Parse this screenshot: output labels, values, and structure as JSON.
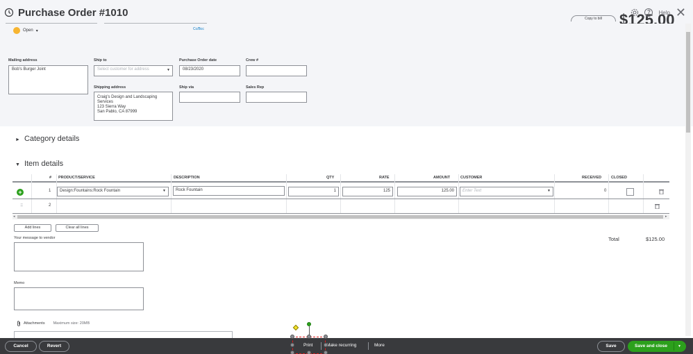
{
  "header": {
    "title": "Purchase Order #1010",
    "status": "Open",
    "cc_bcc": "Cc/Bcc",
    "copy_to_bill": "Copy to bill",
    "amount_big": "$125.00",
    "help": "Help"
  },
  "form": {
    "mailing_address_label": "Mailing address",
    "mailing_address": "Bob's Burger Joint",
    "ship_to_label": "Ship to",
    "ship_to_placeholder": "Select customer for address",
    "po_date_label": "Purchase Order date",
    "po_date": "08/23/2020",
    "crew_label": "Crew #",
    "shipping_address_label": "Shipping address",
    "shipping_address_lines": [
      "Craig's Design and Landscaping",
      "Services",
      "123 Sierra Way",
      "San Pablo, CA  87999"
    ],
    "ship_via_label": "Ship via",
    "sales_rep_label": "Sales Rep"
  },
  "sections": {
    "category_details": "Category details",
    "item_details": "Item details"
  },
  "table": {
    "headers": {
      "num": "#",
      "product": "PRODUCT/SERVICE",
      "description": "DESCRIPTION",
      "qty": "QTY",
      "rate": "RATE",
      "amount": "AMOUNT",
      "customer": "CUSTOMER",
      "received": "RECEIVED",
      "closed": "CLOSED"
    },
    "rows": [
      {
        "num": "1",
        "product": "Design:Fountains:Rock Fountain",
        "description": "Rock Fountain",
        "qty": "1",
        "rate": "125",
        "amount": "125.00",
        "customer_placeholder": "Enter Text",
        "received": "0"
      },
      {
        "num": "2"
      }
    ]
  },
  "actions": {
    "add_lines": "Add lines",
    "clear_all_lines": "Clear all lines"
  },
  "message_label": "Your message to vendor",
  "memo_label": "Memo",
  "totals": {
    "label": "Total",
    "value": "$125.00"
  },
  "attachments": {
    "label": "Attachments",
    "max_size": "Maximum size: 20MB"
  },
  "footer": {
    "cancel": "Cancel",
    "revert": "Revert",
    "print": "Print",
    "make_recurring": "Make recurring",
    "more": "More",
    "save": "Save",
    "save_and_close": "Save and close"
  },
  "colors": {
    "accent": "#2ca01c",
    "footer_bg": "#393a3d",
    "header_bg": "#f4f5f8",
    "status_dot": "#f7b531",
    "link": "#0077c5"
  }
}
